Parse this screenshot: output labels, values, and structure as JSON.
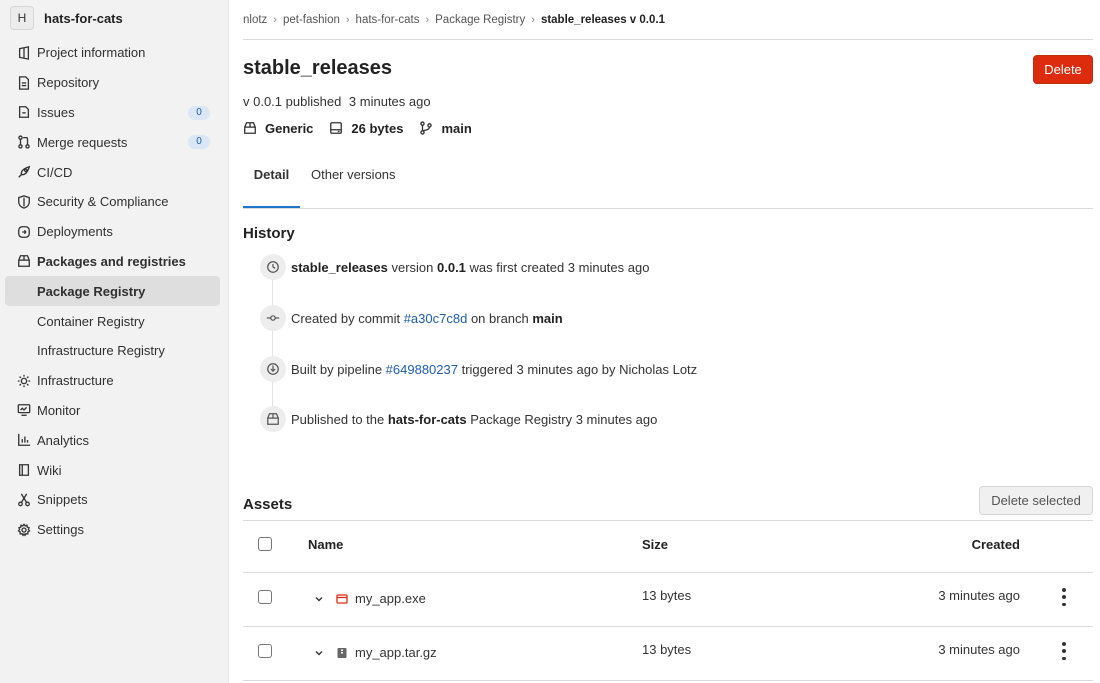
{
  "project": {
    "avatar_letter": "H",
    "name": "hats-for-cats"
  },
  "sidebar": {
    "items": [
      {
        "label": "Project information",
        "icon": "project-icon"
      },
      {
        "label": "Repository",
        "icon": "document-icon"
      },
      {
        "label": "Issues",
        "icon": "issues-icon",
        "badge": "0"
      },
      {
        "label": "Merge requests",
        "icon": "merge-request-icon",
        "badge": "0"
      },
      {
        "label": "CI/CD",
        "icon": "rocket-icon"
      },
      {
        "label": "Security & Compliance",
        "icon": "shield-icon"
      },
      {
        "label": "Deployments",
        "icon": "deployments-icon"
      },
      {
        "label": "Packages and registries",
        "icon": "package-icon"
      },
      {
        "label": "Package Registry"
      },
      {
        "label": "Container Registry"
      },
      {
        "label": "Infrastructure Registry"
      },
      {
        "label": "Infrastructure",
        "icon": "cloud-gear-icon"
      },
      {
        "label": "Monitor",
        "icon": "monitor-icon"
      },
      {
        "label": "Analytics",
        "icon": "chart-icon"
      },
      {
        "label": "Wiki",
        "icon": "book-icon"
      },
      {
        "label": "Snippets",
        "icon": "scissors-icon"
      },
      {
        "label": "Settings",
        "icon": "gear-icon"
      }
    ]
  },
  "breadcrumb": [
    "nlotz",
    "pet-fashion",
    "hats-for-cats",
    "Package Registry",
    "stable_releases v 0.0.1"
  ],
  "package": {
    "title": "stable_releases",
    "delete_label": "Delete",
    "published_version": "v 0.0.1 published",
    "published_time": "3 minutes ago",
    "type": "Generic",
    "size": "26 bytes",
    "branch": "main"
  },
  "tabs": [
    "Detail",
    "Other versions"
  ],
  "history": {
    "heading": "History",
    "entries": [
      {
        "bold_a": "stable_releases",
        "text_a": " version ",
        "bold_b": "0.0.1",
        "text_b": " was first created 3 minutes ago",
        "icon": "clock-icon"
      },
      {
        "text_a": "Created by commit ",
        "link": "#a30c7c8d",
        "text_b": " on branch ",
        "bold_b": "main",
        "icon": "commit-icon"
      },
      {
        "text_a": "Built by pipeline ",
        "link": "#649880237",
        "text_b": " triggered 3 minutes ago by Nicholas Lotz",
        "icon": "pipeline-icon"
      },
      {
        "text_a": "Published to the ",
        "bold_a": "hats-for-cats",
        "text_b": " Package Registry 3 minutes ago",
        "icon": "package-icon"
      }
    ]
  },
  "assets": {
    "heading": "Assets",
    "delete_selected_label": "Delete selected",
    "columns": {
      "name": "Name",
      "size": "Size",
      "created": "Created"
    },
    "rows": [
      {
        "name": "my_app.exe",
        "size": "13 bytes",
        "created": "3 minutes ago",
        "icon": "application-icon"
      },
      {
        "name": "my_app.tar.gz",
        "size": "13 bytes",
        "created": "3 minutes ago",
        "icon": "archive-icon"
      }
    ]
  },
  "colors": {
    "danger": "#dd2b0e",
    "link": "#1f5ca8",
    "tab_active": "#1f75cb"
  }
}
